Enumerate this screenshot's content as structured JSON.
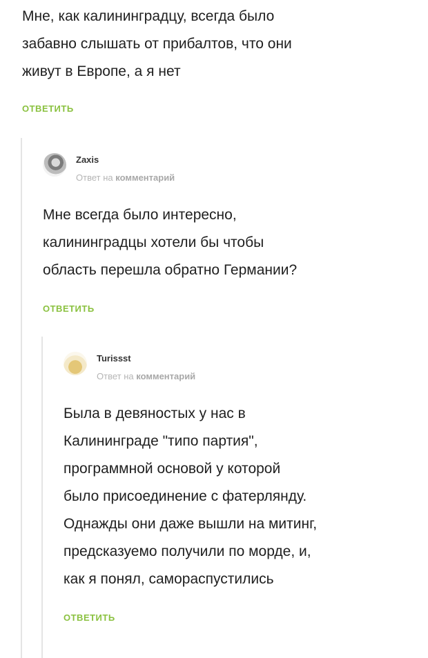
{
  "thread": {
    "root": {
      "lines": [
        "Мне, как калининградцу, всегда было",
        "забавно слышать от прибалтов, что они",
        "живут в Европе, а я нет"
      ],
      "reply_label": "ОТВЕТИТЬ"
    },
    "reply1": {
      "username": "Zaxis",
      "reply_prefix": "Ответ на",
      "reply_target": "комментарий",
      "lines": [
        "Мне всегда было интересно,",
        "калининградцы хотели бы чтобы",
        "область перешла обратно Германии?"
      ],
      "reply_label": "ОТВЕТИТЬ"
    },
    "reply2": {
      "username": "Turissst",
      "reply_prefix": "Ответ на",
      "reply_target": "комментарий",
      "lines": [
        "Была в девяностых у нас в",
        "Калининграде \"типо партия\",",
        "программной основой у которой",
        "было присоединение с фатерлянду.",
        "Однажды они даже вышли на митинг,",
        "предсказуемо получили по морде, и,",
        "как я понял, самораспустились"
      ],
      "reply_label": "ОТВЕТИТЬ"
    }
  },
  "colors": {
    "accent": "#8ac13f",
    "text": "#1f1f1f",
    "muted": "#b5b5b5",
    "thread_line": "#e4e4e4"
  },
  "icons": {
    "avatar_zaxis": "user-avatar-icon",
    "avatar_turissst": "user-avatar-icon"
  }
}
